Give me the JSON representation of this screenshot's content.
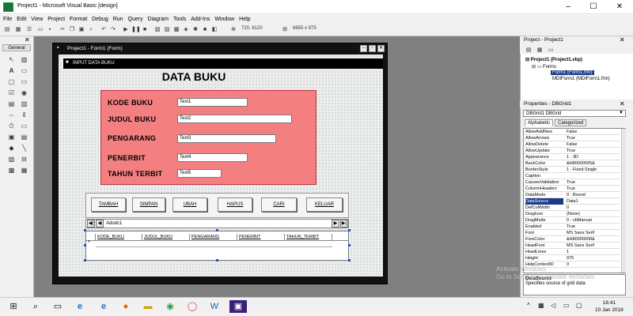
{
  "window": {
    "title": "Project1 - Microsoft Visual Basic [design]",
    "min": "–",
    "max": "☐",
    "close": "✕"
  },
  "menu": [
    "File",
    "Edit",
    "View",
    "Project",
    "Format",
    "Debug",
    "Run",
    "Query",
    "Diagram",
    "Tools",
    "Add-Ins",
    "Window",
    "Help"
  ],
  "toolbar": {
    "coords": "720, 6120",
    "size": "8655 x 975"
  },
  "toolbox": {
    "header": "General"
  },
  "form_window": {
    "title": "Project1 - Form1 (Form)"
  },
  "form": {
    "caption": "INPUT DATA BUKU",
    "heading": "DATA BUKU",
    "fields": [
      {
        "label": "KODE BUKU",
        "value": "Text1"
      },
      {
        "label": "JUDUL BUKU",
        "value": "Text2"
      },
      {
        "label": "PENGARANG",
        "value": "Text3"
      },
      {
        "label": "PENERBIT",
        "value": "Text4"
      },
      {
        "label": "TAHUN TERBIT",
        "value": "Text5"
      }
    ],
    "buttons": [
      "TAMBAH",
      "SIMPAN",
      "UBAH",
      "HAPUS",
      "CARI",
      "KELUAR"
    ],
    "adodc_caption": "Adodc1",
    "grid_columns": [
      "KODE_BUKU",
      "JUDUL_BUKU",
      "PENGARANG",
      "PENERBIT",
      "TAHUN_TERBIT"
    ],
    "grid_row_marker": "*"
  },
  "project_explorer": {
    "title": "Project - Project1",
    "root": "Project1 (Project1.vbp)",
    "folder": "Forms",
    "items": [
      "Form1 (Form1.frm)",
      "MDIForm1 (MDIForm1.frm)"
    ]
  },
  "properties": {
    "title": "Properties - DBGrid1",
    "selector": "DBGrid1 DBGrid",
    "tabs": [
      "Alphabetic",
      "Categorized"
    ],
    "rows": [
      {
        "name": "AllowAddNew",
        "value": "False"
      },
      {
        "name": "AllowArrows",
        "value": "True"
      },
      {
        "name": "AllowDelete",
        "value": "False"
      },
      {
        "name": "AllowUpdate",
        "value": "True"
      },
      {
        "name": "Appearance",
        "value": "1 - 3D"
      },
      {
        "name": "BackColor",
        "value": "&H80000005&"
      },
      {
        "name": "BorderStyle",
        "value": "1 - Fixed Single"
      },
      {
        "name": "Caption",
        "value": ""
      },
      {
        "name": "CausesValidation",
        "value": "True"
      },
      {
        "name": "ColumnHeaders",
        "value": "True"
      },
      {
        "name": "DataMode",
        "value": "0 - Bound"
      },
      {
        "name": "DataSource",
        "value": "Data1"
      },
      {
        "name": "DefColWidth",
        "value": "0"
      },
      {
        "name": "DragIcon",
        "value": "(None)"
      },
      {
        "name": "DragMode",
        "value": "0 - vbManual"
      },
      {
        "name": "Enabled",
        "value": "True"
      },
      {
        "name": "Font",
        "value": "MS Sans Serif"
      },
      {
        "name": "ForeColor",
        "value": "&H80000008&"
      },
      {
        "name": "HeadFont",
        "value": "MS Sans Serif"
      },
      {
        "name": "HeadLines",
        "value": "1"
      },
      {
        "name": "Height",
        "value": "975"
      },
      {
        "name": "HelpContextID",
        "value": "0"
      }
    ],
    "selected_index": 11,
    "desc_title": "DataSource",
    "desc_text": "Specifies source of grid data"
  },
  "watermark": {
    "line1": "Activate Windows",
    "line2": "Go to Settings to activate Windows."
  },
  "taskbar": {
    "time": "18.41",
    "date": "10 Jan 2018"
  },
  "colors": {
    "panel": "#f47f80",
    "selection": "#1c3a8c"
  }
}
